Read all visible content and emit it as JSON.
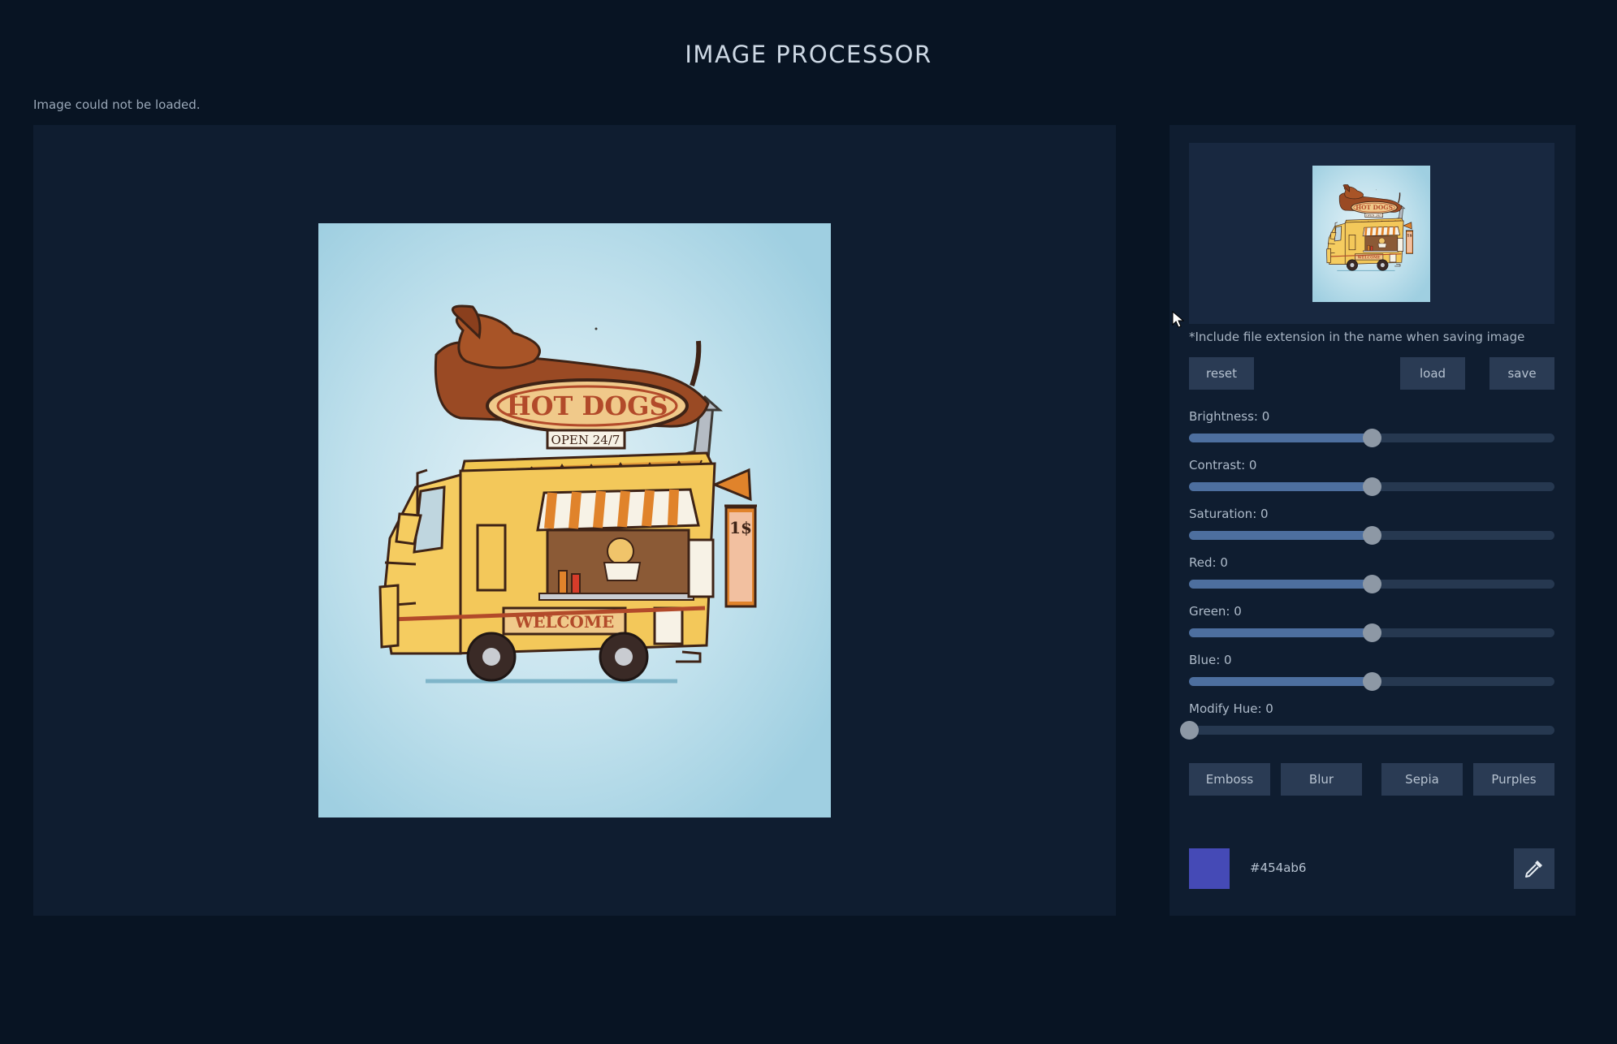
{
  "header": {
    "title": "IMAGE PROCESSOR"
  },
  "status": {
    "message": "Image could not be loaded."
  },
  "controls": {
    "hint": "*Include file extension in the name when saving image",
    "reset_label": "reset",
    "load_label": "load",
    "save_label": "save"
  },
  "sliders": [
    {
      "label": "Brightness: 0",
      "level": 0.5
    },
    {
      "label": "Contrast: 0",
      "level": 0.5
    },
    {
      "label": "Saturation: 0",
      "level": 0.5
    },
    {
      "label": "Red: 0",
      "level": 0.5
    },
    {
      "label": "Green: 0",
      "level": 0.5
    },
    {
      "label": "Blue: 0",
      "level": 0.5
    },
    {
      "label": "Modify Hue: 0",
      "level": 0.0
    }
  ],
  "filters": {
    "emboss_label": "Emboss",
    "blur_label": "Blur",
    "sepia_label": "Sepia",
    "purples_label": "Purples"
  },
  "color": {
    "hex": "#454ab6",
    "swatch": "#454ab6",
    "picker_icon": "eyedropper-icon"
  },
  "colors": {
    "page_bg": "#081423",
    "panel_bg": "#0f1d30",
    "button_bg": "#2a3b54",
    "slider_fill": "#4d6f9f",
    "slider_track": "#263850"
  }
}
